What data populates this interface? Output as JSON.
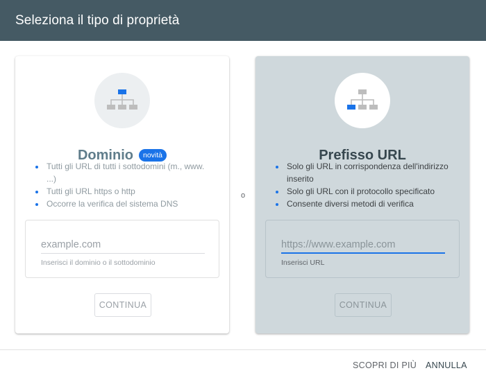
{
  "dialog": {
    "title": "Seleziona il tipo di proprietà"
  },
  "cards": {
    "domain": {
      "icon": "sitemap-icon",
      "title": "Dominio",
      "badge": "novità",
      "features": [
        "Tutti gli URL di tutti i sottodomini (m., www. ...)",
        "Tutti gli URL https o http",
        "Occorre la verifica del sistema DNS"
      ],
      "input": {
        "placeholder": "example.com",
        "hint": "Inserisci il dominio o il sottodominio"
      },
      "continue_label": "CONTINUA"
    },
    "separator": "o",
    "url_prefix": {
      "icon": "sitemap-icon",
      "title": "Prefisso URL",
      "features": [
        "Solo gli URL in corrispondenza dell'indirizzo inserito",
        "Solo gli URL con il protocollo specificato",
        "Consente diversi metodi di verifica"
      ],
      "input": {
        "placeholder": "https://www.example.com",
        "hint": "Inserisci URL"
      },
      "continue_label": "CONTINUA"
    }
  },
  "footer": {
    "learn_more_label": "SCOPRI DI PIÙ",
    "cancel_label": "ANNULLA"
  },
  "colors": {
    "header_bg": "#455a64",
    "selected_card_bg": "#cfd8dc",
    "accent": "#1a73e8"
  }
}
